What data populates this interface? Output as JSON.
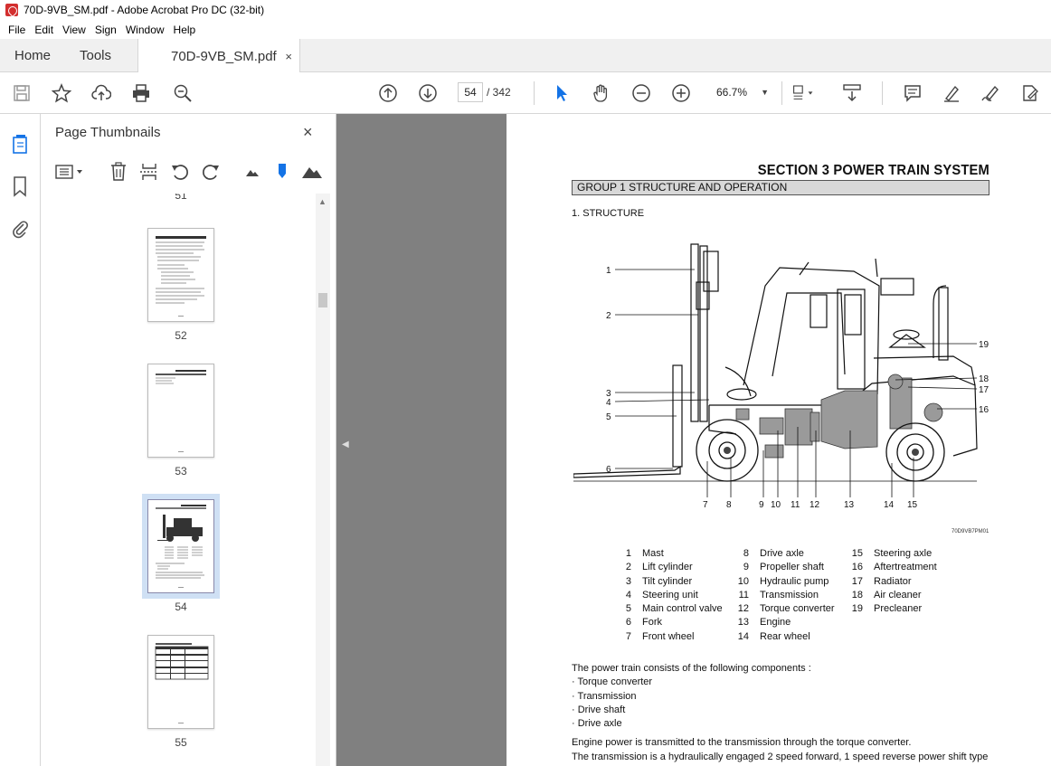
{
  "window": {
    "title": "70D-9VB_SM.pdf - Adobe Acrobat Pro DC (32-bit)"
  },
  "menu": [
    "File",
    "Edit",
    "View",
    "Sign",
    "Window",
    "Help"
  ],
  "tabs": {
    "home": "Home",
    "tools": "Tools",
    "document": "70D-9VB_SM.pdf",
    "close": "×"
  },
  "toolbar": {
    "page_current": "54",
    "page_total": "/ 342",
    "zoom": "66.7%"
  },
  "thumbnails": {
    "title": "Page Thumbnails",
    "close": "×",
    "pages": [
      {
        "label": "51"
      },
      {
        "label": "52"
      },
      {
        "label": "53"
      },
      {
        "label": "54",
        "selected": true
      },
      {
        "label": "55"
      }
    ]
  },
  "document": {
    "section_title": "SECTION  3  POWER TRAIN SYSTEM",
    "group_title": "GROUP  1  STRUCTURE AND OPERATION",
    "structure_heading": "1. STRUCTURE",
    "figure_code": "70D9VB7PM01",
    "callouts": [
      "1",
      "2",
      "3",
      "4",
      "5",
      "6",
      "7",
      "8",
      "9",
      "10",
      "11",
      "12",
      "13",
      "14",
      "15",
      "16",
      "17",
      "18",
      "19"
    ],
    "parts": [
      {
        "num": "1",
        "name": "Mast"
      },
      {
        "num": "2",
        "name": "Lift cylinder"
      },
      {
        "num": "3",
        "name": "Tilt cylinder"
      },
      {
        "num": "4",
        "name": "Steering unit"
      },
      {
        "num": "5",
        "name": "Main control valve"
      },
      {
        "num": "6",
        "name": "Fork"
      },
      {
        "num": "7",
        "name": "Front wheel"
      },
      {
        "num": "8",
        "name": "Drive axle"
      },
      {
        "num": "9",
        "name": "Propeller shaft"
      },
      {
        "num": "10",
        "name": "Hydraulic pump"
      },
      {
        "num": "11",
        "name": "Transmission"
      },
      {
        "num": "12",
        "name": "Torque converter"
      },
      {
        "num": "13",
        "name": "Engine"
      },
      {
        "num": "14",
        "name": "Rear wheel"
      },
      {
        "num": "15",
        "name": "Steering axle"
      },
      {
        "num": "16",
        "name": "Aftertreatment"
      },
      {
        "num": "17",
        "name": "Radiator"
      },
      {
        "num": "18",
        "name": "Air cleaner"
      },
      {
        "num": "19",
        "name": "Precleaner"
      }
    ],
    "body": {
      "intro": "The power train consists of the following components :",
      "components": [
        "· Torque converter",
        "· Transmission",
        "· Drive shaft",
        "· Drive axle"
      ],
      "p1": "Engine power is transmitted to the transmission through the torque converter.",
      "p2": "The transmission is a hydraulically engaged 2 speed forward, 1 speed reverse power shift type"
    }
  }
}
